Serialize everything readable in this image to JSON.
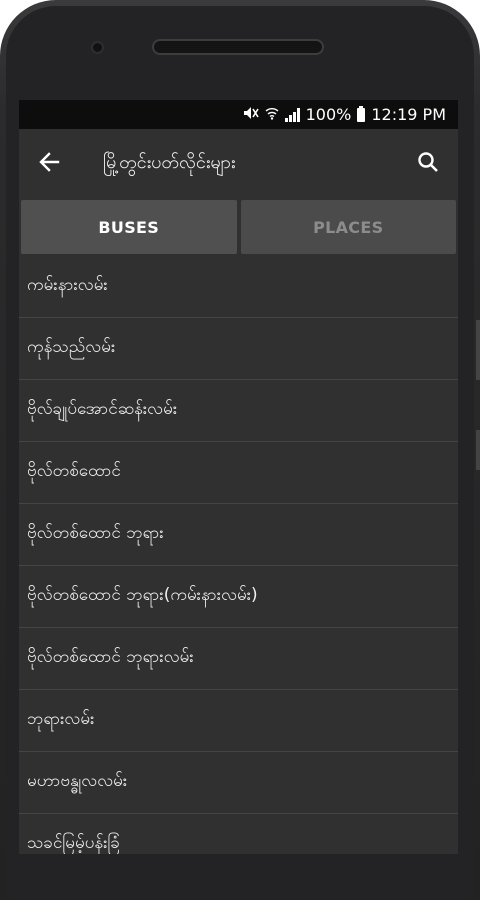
{
  "statusbar": {
    "battery": "100%",
    "time": "12:19 PM"
  },
  "appbar": {
    "title": "မြို့တွင်းပတ်လိုင်းများ",
    "back_icon": "arrow-left-icon",
    "search_icon": "search-icon"
  },
  "tabs": [
    {
      "label": "BUSES",
      "active": true
    },
    {
      "label": "PLACES",
      "active": false
    }
  ],
  "list": [
    {
      "label": "ကမ်းနားလမ်း"
    },
    {
      "label": "ကုန်သည်လမ်း"
    },
    {
      "label": "ဗိုလ်ချုပ်အောင်ဆန်းလမ်း"
    },
    {
      "label": "ဗိုလ်တစ်ထောင်"
    },
    {
      "label": "ဗိုလ်တစ်ထောင် ဘုရား"
    },
    {
      "label": "ဗိုလ်တစ်ထောင် ဘုရား(ကမ်းနားလမ်း)"
    },
    {
      "label": "ဗိုလ်တစ်ထောင် ဘုရားလမ်း"
    },
    {
      "label": "ဘုရားလမ်း"
    },
    {
      "label": "မဟာဗန္ဓုလလမ်း"
    },
    {
      "label": "သခင်မြမ့်ပန်းခြံ"
    }
  ],
  "colors": {
    "screen_bg": "#303030",
    "tab_active_bg": "#505050",
    "tab_inactive_text": "#8c8c8c"
  }
}
